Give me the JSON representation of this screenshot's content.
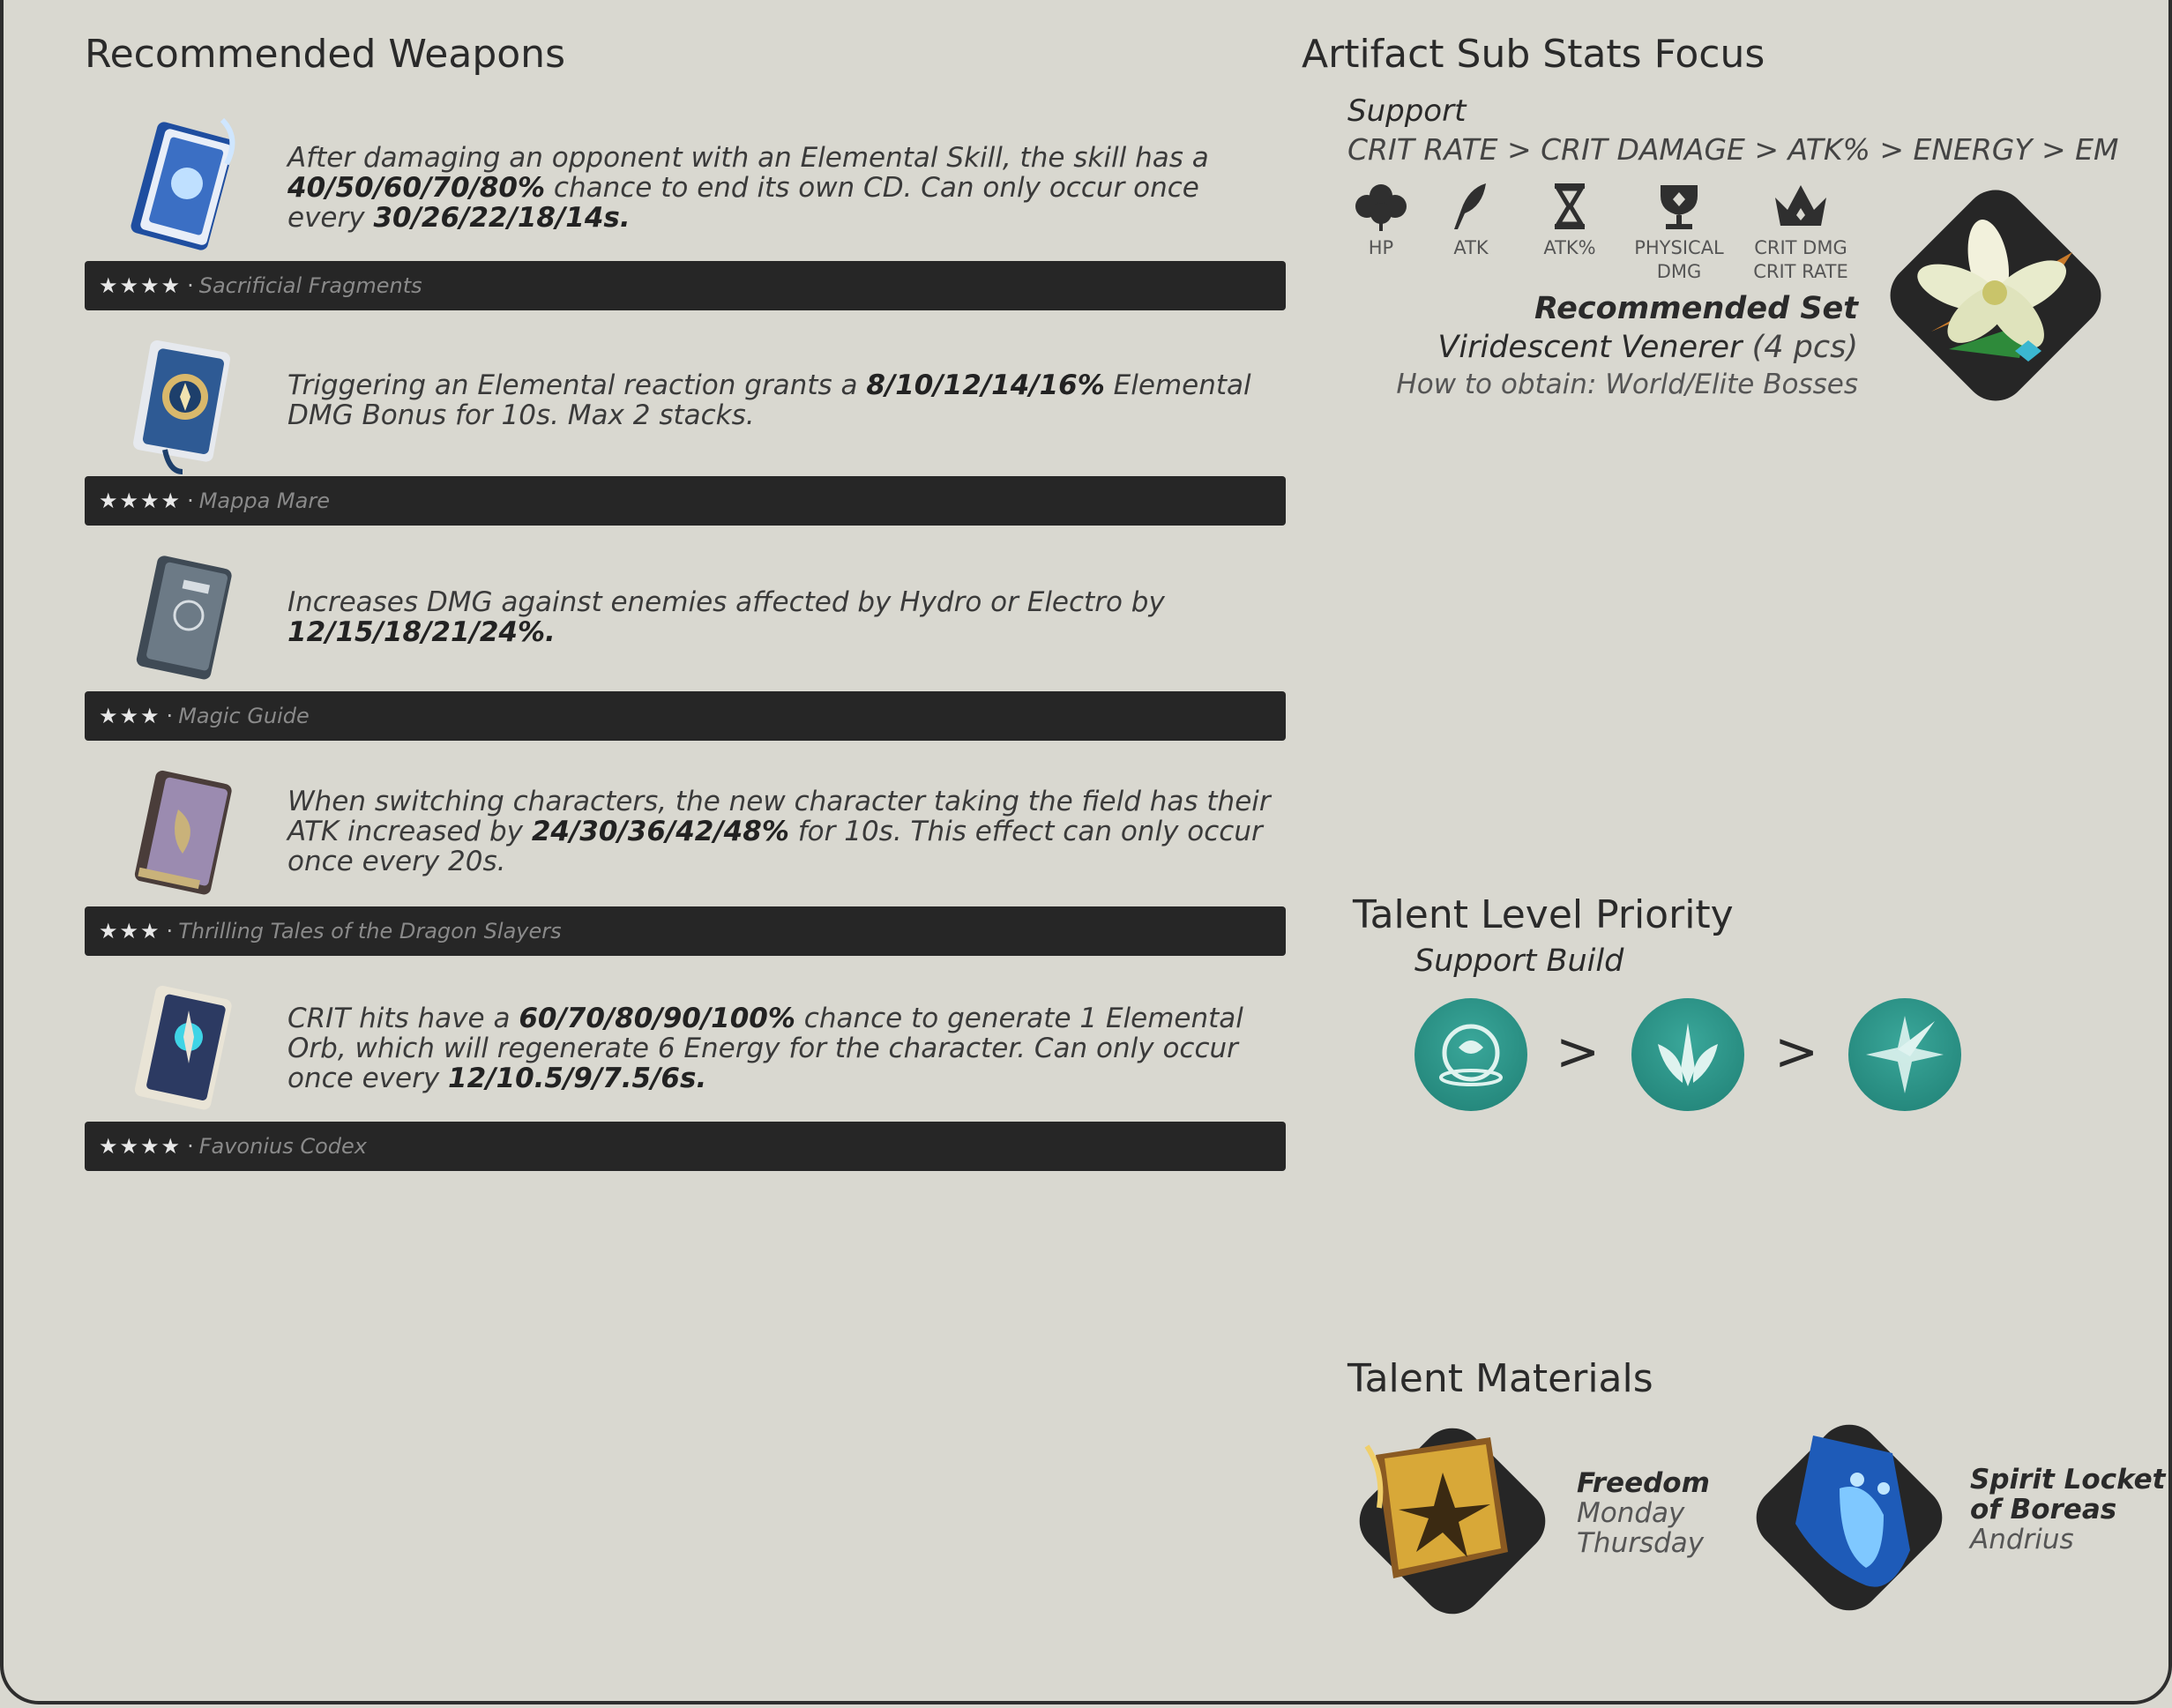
{
  "weapons_section": {
    "title": "Recommended Weapons",
    "weapons": [
      {
        "rarity": "★★★★",
        "name": "Sacrificial Fragments",
        "desc_parts": [
          "After damaging an opponent with an Elemental Skill, the skill has a ",
          "40/50/60/70/80%",
          " chance to end its own CD. Can only occur once every ",
          "30/26/22/18/14s."
        ]
      },
      {
        "rarity": "★★★★",
        "name": "Mappa Mare",
        "desc_parts": [
          "Triggering an Elemental reaction grants a ",
          "8/10/12/14/16%",
          " Elemental DMG Bonus for 10s. Max 2 stacks.",
          ""
        ]
      },
      {
        "rarity": "★★★",
        "name": "Magic Guide",
        "desc_parts": [
          "Increases DMG against enemies affected by Hydro or Electro by ",
          "12/15/18/21/24%.",
          "",
          ""
        ]
      },
      {
        "rarity": "★★★",
        "name": "Thrilling Tales of the Dragon Slayers",
        "desc_parts": [
          "When switching characters, the new character taking the field has their ATK increased by ",
          "24/30/36/42/48%",
          " for 10s. This effect can only occur once every 20s.",
          ""
        ]
      },
      {
        "rarity": "★★★★",
        "name": "Favonius Codex",
        "desc_parts": [
          " CRIT hits have a ",
          "60/70/80/90/100%",
          " chance to generate 1 Elemental Orb, which will regenerate 6 Energy for the character. Can only occur once every ",
          "12/10.5/9/7.5/6s."
        ]
      }
    ]
  },
  "artifact": {
    "title": "Artifact Sub Stats Focus",
    "role": "Support",
    "priority": "CRIT RATE > CRIT DAMAGE > ATK% > ENERGY > EM",
    "stats": [
      {
        "icon": "flower-icon",
        "label": "HP"
      },
      {
        "icon": "plume-icon",
        "label": "ATK"
      },
      {
        "icon": "sands-icon",
        "label": "ATK%"
      },
      {
        "icon": "goblet-icon",
        "label": "PHYSICAL",
        "label2": "DMG"
      },
      {
        "icon": "circlet-icon",
        "label": "CRIT DMG",
        "label2": "CRIT RATE"
      }
    ],
    "set_label": "Recommended Set",
    "set_name": "Viridescent Venerer",
    "set_pieces": "(4 pcs)",
    "obtain": "How to obtain: World/Elite Bosses"
  },
  "talent_priority": {
    "title": "Talent Level Priority",
    "build": "Support Build",
    "separator": ">"
  },
  "talent_materials": {
    "title": "Talent Materials",
    "items": [
      {
        "name": "Freedom",
        "line1": "Monday",
        "line2": "Thursday"
      },
      {
        "name_line1": "Spirit Locket",
        "name_line2": "of Boreas",
        "line1": "Andrius"
      }
    ]
  },
  "colors": {
    "background": "#d9d8d0",
    "bar": "#262626",
    "talent": "#2a9589"
  }
}
